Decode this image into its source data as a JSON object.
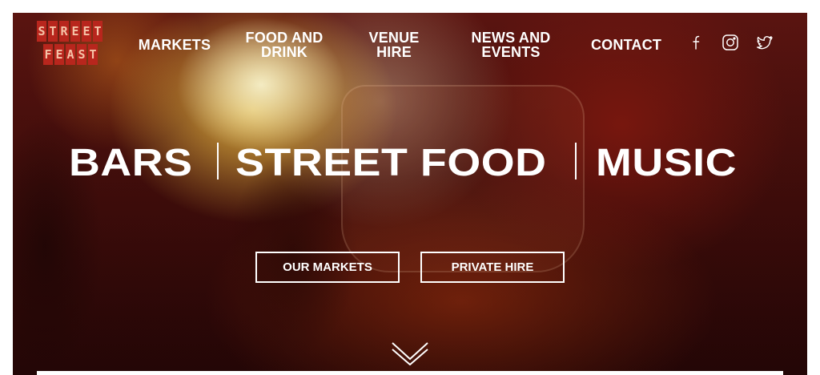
{
  "logo": {
    "row1": [
      "S",
      "T",
      "R",
      "E",
      "E",
      "T"
    ],
    "row2": [
      "F",
      "E",
      "A",
      "S",
      "T"
    ],
    "tile_color": "#b8261d",
    "letter_color": "#f5c4a8"
  },
  "nav": {
    "markets": "MARKETS",
    "food_line1": "FOOD AND",
    "food_line2": "DRINK",
    "venue_line1": "VENUE",
    "venue_line2": "HIRE",
    "news_line1": "NEWS AND",
    "news_line2": "EVENTS",
    "contact": "CONTACT"
  },
  "social": {
    "icons": [
      "facebook-icon",
      "instagram-icon",
      "twitter-icon"
    ]
  },
  "hero": {
    "words": [
      "BARS",
      "STREET FOOD",
      "MUSIC"
    ],
    "buttons": {
      "markets": "OUR MARKETS",
      "private_hire": "PRIVATE HIRE"
    }
  },
  "colors": {
    "text": "#ffffff",
    "background_dark": "#3b0c0a"
  }
}
